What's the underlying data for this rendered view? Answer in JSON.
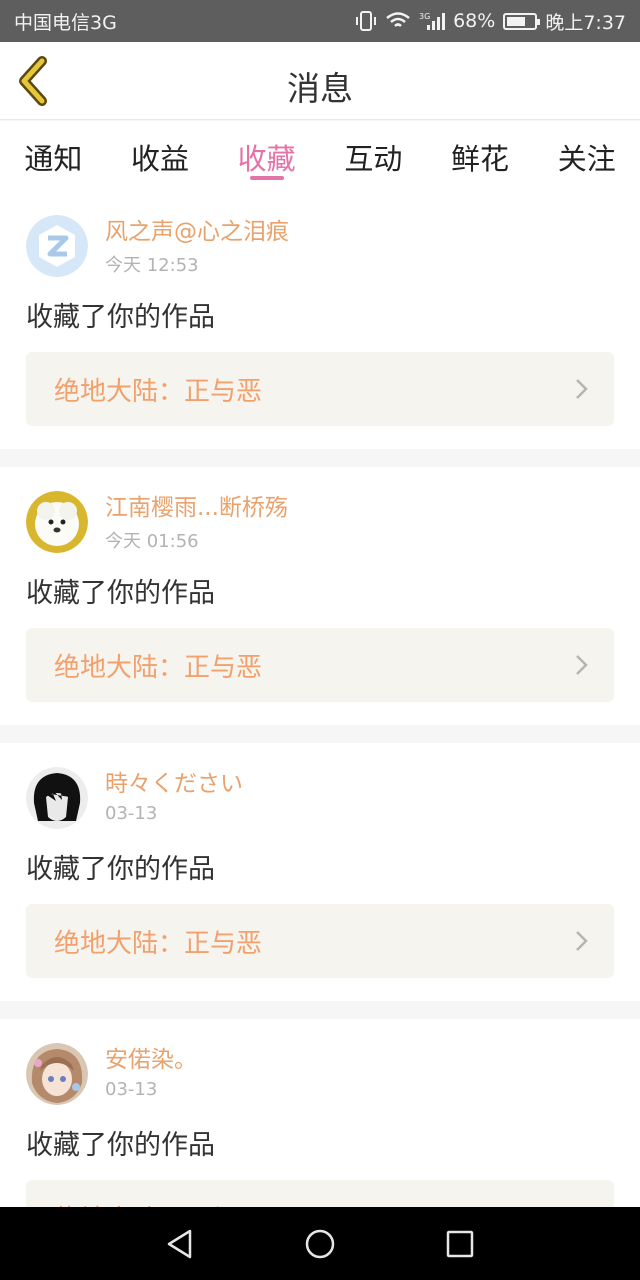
{
  "status_bar": {
    "carrier": "中国电信3G",
    "network": "3G",
    "battery": "68%",
    "battery_level": 0.68,
    "time": "晚上7:37",
    "icons": [
      "vibrate-icon",
      "wifi-icon",
      "signal-icon",
      "battery-icon"
    ]
  },
  "header": {
    "title": "消息",
    "back_icon": "chevron-left-icon",
    "accent": "#e8c63a"
  },
  "tabs": [
    {
      "label": "通知",
      "active": false
    },
    {
      "label": "收益",
      "active": false
    },
    {
      "label": "收藏",
      "active": true
    },
    {
      "label": "互动",
      "active": false
    },
    {
      "label": "鲜花",
      "active": false
    },
    {
      "label": "关注",
      "active": false
    }
  ],
  "colors": {
    "accent": "#e374a8",
    "username": "#e9a26c",
    "work_title": "#f2a06c",
    "work_bg": "#f5f4ee"
  },
  "messages": [
    {
      "user": "风之声@心之泪痕",
      "time": "今天 12:53",
      "action": "收藏了你的作品",
      "work": "绝地大陆：正与恶",
      "avatar": "default-z-avatar"
    },
    {
      "user": "江南樱雨...断桥殇",
      "time": "今天 01:56",
      "action": "收藏了你的作品",
      "work": "绝地大陆：正与恶",
      "avatar": "white-dog-avatar"
    },
    {
      "user": "時々ください",
      "time": "03-13",
      "action": "收藏了你的作品",
      "work": "绝地大陆：正与恶",
      "avatar": "dark-hair-avatar"
    },
    {
      "user": "安偌染。",
      "time": "03-13",
      "action": "收藏了你的作品",
      "work": "绝地大陆：正与恶",
      "avatar": "anime-girl-avatar"
    }
  ],
  "nav_bar": {
    "icons": [
      "back-triangle-icon",
      "home-circle-icon",
      "recents-square-icon"
    ]
  }
}
